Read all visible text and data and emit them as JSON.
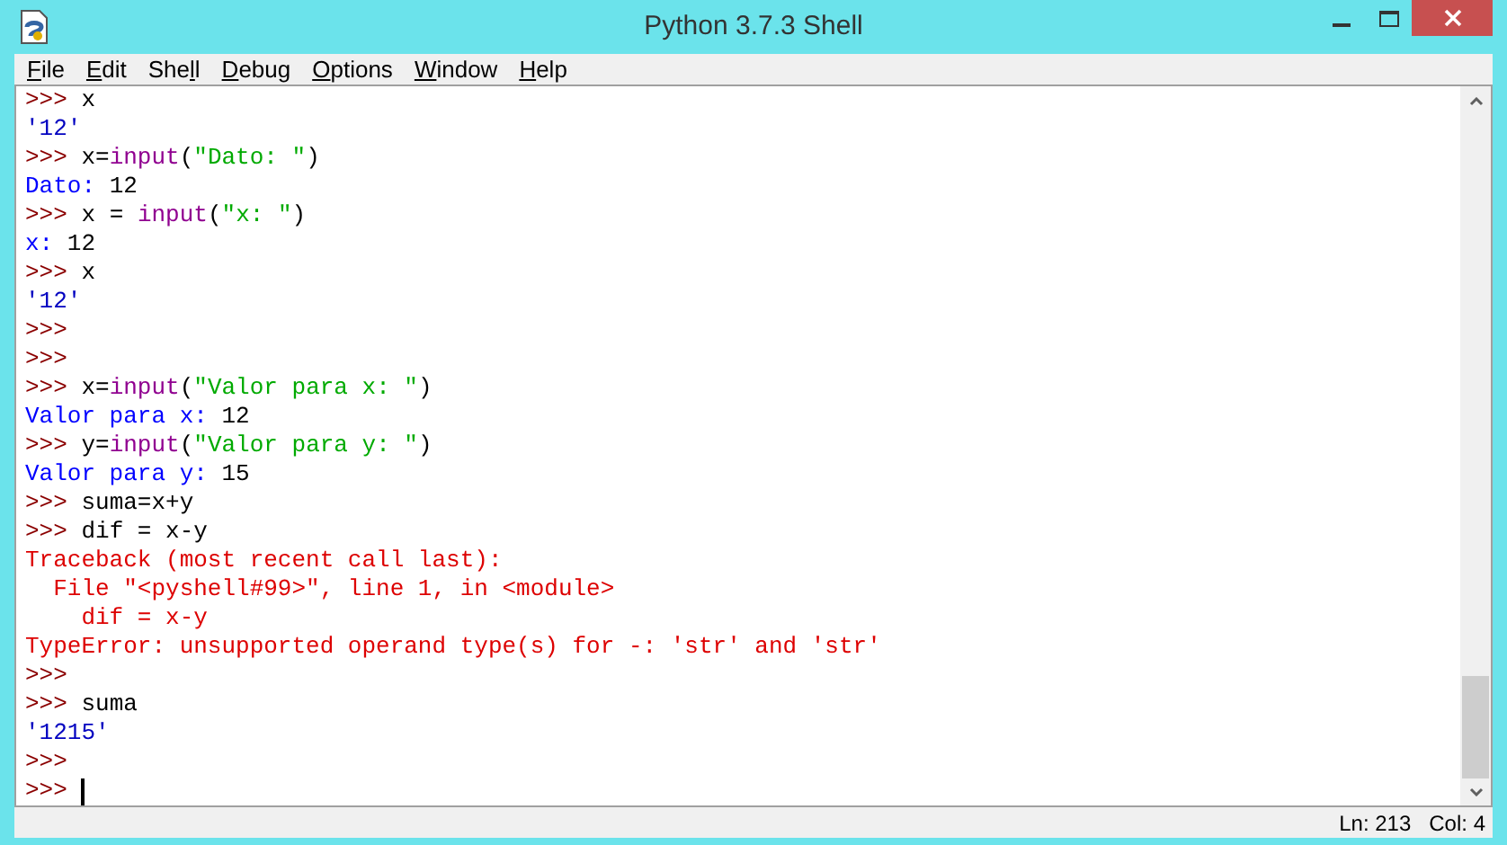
{
  "window": {
    "title": "Python 3.7.3 Shell"
  },
  "menu": [
    {
      "key": "F",
      "post": "ile"
    },
    {
      "key": "E",
      "post": "dit"
    },
    {
      "pre": "She",
      "key": "l",
      "post": "l"
    },
    {
      "key": "D",
      "post": "ebug"
    },
    {
      "key": "O",
      "post": "ptions"
    },
    {
      "key": "W",
      "post": "indow"
    },
    {
      "key": "H",
      "post": "elp"
    }
  ],
  "shell_lines": [
    [
      {
        "kind": "prompt",
        "text": ">>> "
      },
      {
        "kind": "code",
        "text": "x"
      }
    ],
    [
      {
        "kind": "result",
        "text": "'12'"
      }
    ],
    [
      {
        "kind": "prompt",
        "text": ">>> "
      },
      {
        "kind": "code",
        "text": "x="
      },
      {
        "kind": "builtin",
        "text": "input"
      },
      {
        "kind": "code",
        "text": "("
      },
      {
        "kind": "string",
        "text": "\"Dato: \""
      },
      {
        "kind": "code",
        "text": ")"
      }
    ],
    [
      {
        "kind": "stdout",
        "text": "Dato: "
      },
      {
        "kind": "code",
        "text": "12"
      }
    ],
    [
      {
        "kind": "prompt",
        "text": ">>> "
      },
      {
        "kind": "code",
        "text": "x = "
      },
      {
        "kind": "builtin",
        "text": "input"
      },
      {
        "kind": "code",
        "text": "("
      },
      {
        "kind": "string",
        "text": "\"x: \""
      },
      {
        "kind": "code",
        "text": ")"
      }
    ],
    [
      {
        "kind": "stdout",
        "text": "x: "
      },
      {
        "kind": "code",
        "text": "12"
      }
    ],
    [
      {
        "kind": "prompt",
        "text": ">>> "
      },
      {
        "kind": "code",
        "text": "x"
      }
    ],
    [
      {
        "kind": "result",
        "text": "'12'"
      }
    ],
    [
      {
        "kind": "prompt",
        "text": ">>>"
      }
    ],
    [
      {
        "kind": "prompt",
        "text": ">>>"
      }
    ],
    [
      {
        "kind": "prompt",
        "text": ">>> "
      },
      {
        "kind": "code",
        "text": "x="
      },
      {
        "kind": "builtin",
        "text": "input"
      },
      {
        "kind": "code",
        "text": "("
      },
      {
        "kind": "string",
        "text": "\"Valor para x: \""
      },
      {
        "kind": "code",
        "text": ")"
      }
    ],
    [
      {
        "kind": "stdout",
        "text": "Valor para x: "
      },
      {
        "kind": "code",
        "text": "12"
      }
    ],
    [
      {
        "kind": "prompt",
        "text": ">>> "
      },
      {
        "kind": "code",
        "text": "y="
      },
      {
        "kind": "builtin",
        "text": "input"
      },
      {
        "kind": "code",
        "text": "("
      },
      {
        "kind": "string",
        "text": "\"Valor para y: \""
      },
      {
        "kind": "code",
        "text": ")"
      }
    ],
    [
      {
        "kind": "stdout",
        "text": "Valor para y: "
      },
      {
        "kind": "code",
        "text": "15"
      }
    ],
    [
      {
        "kind": "prompt",
        "text": ">>> "
      },
      {
        "kind": "code",
        "text": "suma=x+y"
      }
    ],
    [
      {
        "kind": "prompt",
        "text": ">>> "
      },
      {
        "kind": "code",
        "text": "dif = x-y"
      }
    ],
    [
      {
        "kind": "stderr",
        "text": "Traceback (most recent call last):"
      }
    ],
    [
      {
        "kind": "stderr",
        "text": "  File \"<pyshell#99>\", line 1, in <module>"
      }
    ],
    [
      {
        "kind": "stderr",
        "text": "    dif = x-y"
      }
    ],
    [
      {
        "kind": "stderr",
        "text": "TypeError: unsupported operand type(s) for -: 'str' and 'str'"
      }
    ],
    [
      {
        "kind": "prompt",
        "text": ">>>"
      }
    ],
    [
      {
        "kind": "prompt",
        "text": ">>> "
      },
      {
        "kind": "code",
        "text": "suma"
      }
    ],
    [
      {
        "kind": "result",
        "text": "'1215'"
      }
    ],
    [
      {
        "kind": "prompt",
        "text": ">>>"
      }
    ],
    [
      {
        "kind": "prompt",
        "text": ">>> "
      }
    ]
  ],
  "status_bar": {
    "line": "Ln: 213",
    "column": "Col: 4"
  }
}
